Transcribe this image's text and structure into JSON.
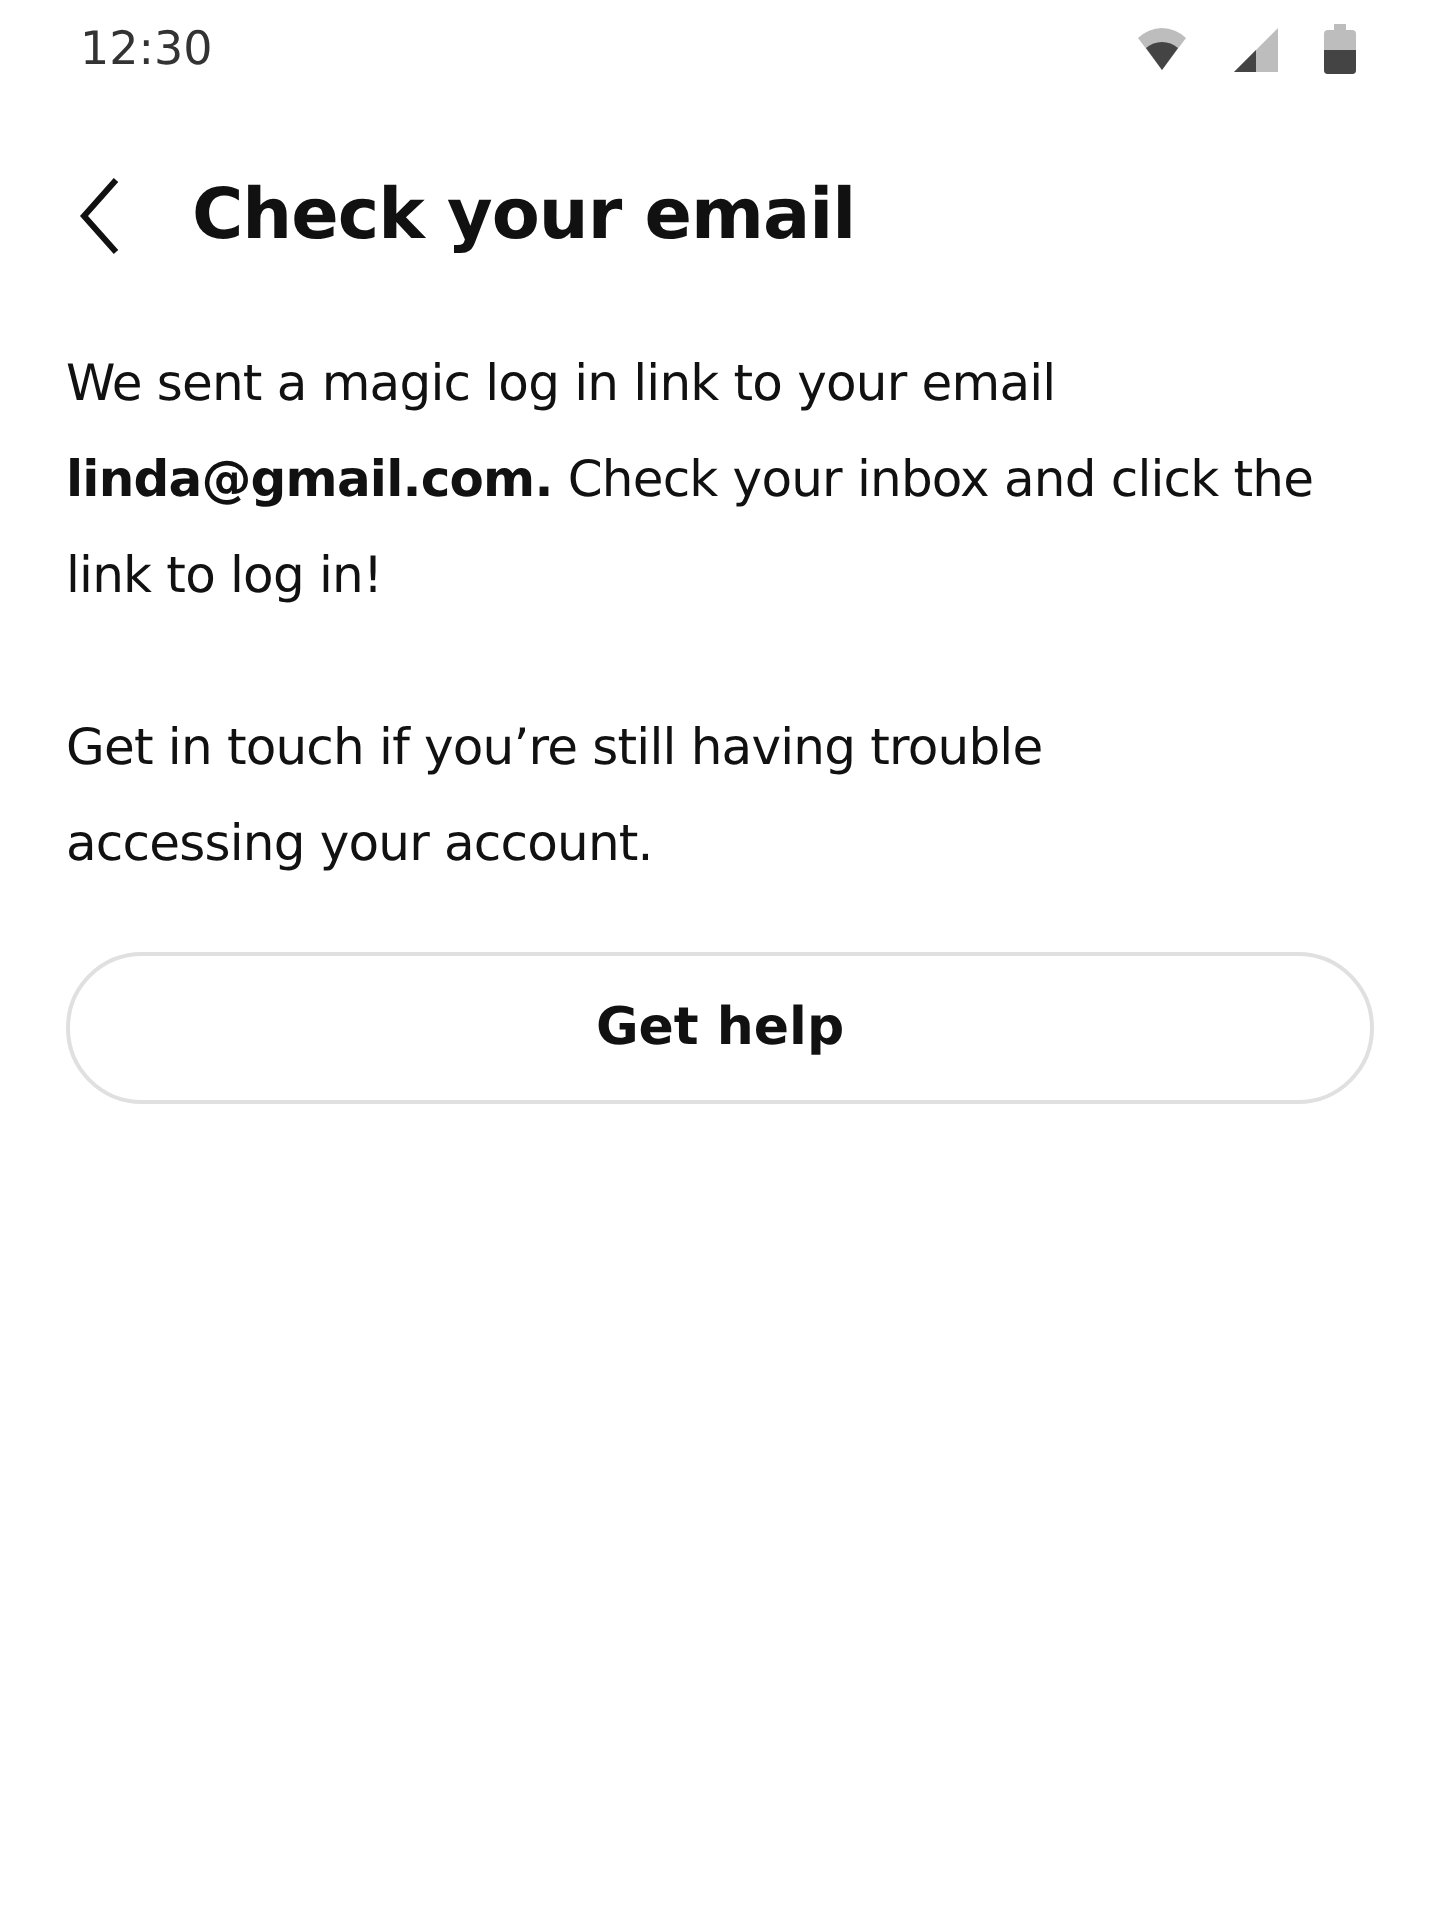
{
  "status_bar": {
    "time": "12:30"
  },
  "header": {
    "title": "Check your email"
  },
  "message": "We sent a magic log in link to your email **linda@gmail.com.** Check your inbox and click the link to log in!",
  "help_text": "Get in touch if you’re still having trouble accessing your account.",
  "button": {
    "label": "Get help"
  }
}
